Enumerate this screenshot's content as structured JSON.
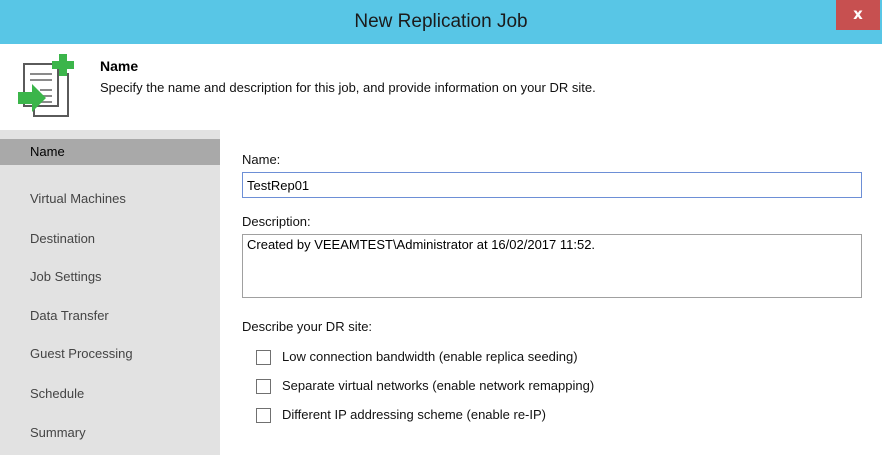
{
  "window": {
    "title": "New Replication Job",
    "close_label": "x"
  },
  "header": {
    "title": "Name",
    "description": "Specify the name and description for this job, and provide information on your DR site."
  },
  "sidebar": {
    "items": [
      {
        "label": "Name",
        "active": true
      },
      {
        "label": "Virtual Machines",
        "active": false
      },
      {
        "label": "Destination",
        "active": false
      },
      {
        "label": "Job Settings",
        "active": false
      },
      {
        "label": "Data Transfer",
        "active": false
      },
      {
        "label": "Guest Processing",
        "active": false
      },
      {
        "label": "Schedule",
        "active": false
      },
      {
        "label": "Summary",
        "active": false
      }
    ]
  },
  "form": {
    "name_label": "Name:",
    "name_value": "TestRep01",
    "description_label": "Description:",
    "description_value": "Created by VEEAMTEST\\Administrator at 16/02/2017 11:52.",
    "dr_site_label": "Describe your DR site:",
    "options": [
      {
        "label": "Low connection bandwidth (enable replica seeding)",
        "checked": false
      },
      {
        "label": "Separate virtual networks (enable network remapping)",
        "checked": false
      },
      {
        "label": "Different IP addressing scheme (enable re-IP)",
        "checked": false
      }
    ]
  },
  "colors": {
    "titlebar": "#58c6e6",
    "close_button": "#c75050",
    "sidebar_bg": "#e2e2e2",
    "sidebar_active": "#a9a9a9",
    "input_focus_border": "#6d8fd6",
    "icon_green": "#3bb54a"
  },
  "icons": {
    "header": "new-replication-job-icon",
    "close": "close-icon"
  }
}
